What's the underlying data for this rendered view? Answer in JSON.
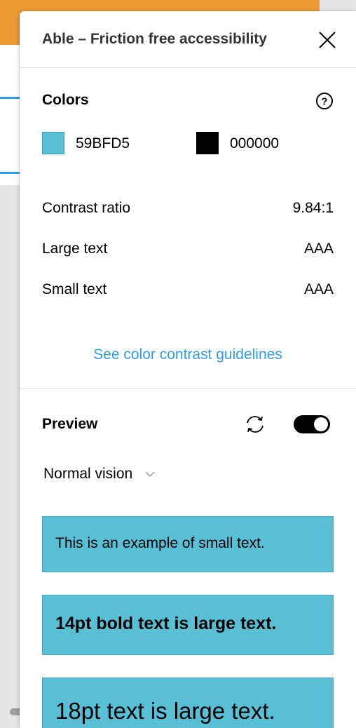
{
  "panel": {
    "title": "Able – Friction free accessibility",
    "close_icon": "close-icon"
  },
  "colors": {
    "section_title": "Colors",
    "help_icon": "help-icon",
    "foreground": {
      "hex": "59BFD5",
      "color": "#59BFD5"
    },
    "background": {
      "hex": "000000",
      "color": "#000000"
    },
    "rows": [
      {
        "label": "Contrast ratio",
        "value": "9.84:1"
      },
      {
        "label": "Large text",
        "value": "AAA"
      },
      {
        "label": "Small text",
        "value": "AAA"
      }
    ],
    "guidelines_link": "See color contrast guidelines",
    "link_color": "#2F9CF0"
  },
  "preview": {
    "section_title": "Preview",
    "refresh_icon": "refresh-icon",
    "toggle_on": true,
    "vision_mode": "Normal vision",
    "samples": [
      {
        "text": "This is an example of small text."
      },
      {
        "text": "14pt bold text is large text."
      },
      {
        "text": "18pt text is large text."
      }
    ]
  },
  "background_app": {
    "accent_color": "#EB9A33",
    "line_color": "#2F9CF0"
  }
}
